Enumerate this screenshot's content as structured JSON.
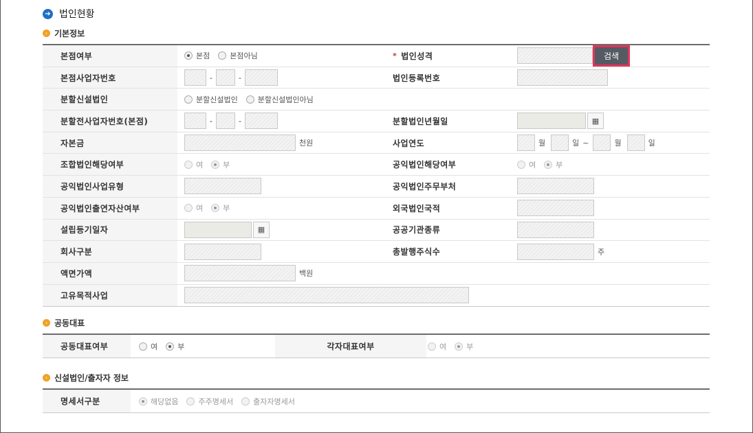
{
  "page_title": "법인현황",
  "basic": {
    "section_title": "기본정보",
    "rows": [
      {
        "label_a": "본점여부",
        "radio_a": [
          "본점",
          "본점아님"
        ],
        "label_b": "법인성격",
        "search_btn": "검색"
      },
      {
        "label_a": "본점사업자번호",
        "label_b": "법인등록번호"
      },
      {
        "label_a": "분할신설법인",
        "radio_a": [
          "분할신설법인",
          "분할신설법인아님"
        ]
      },
      {
        "label_a": "분할전사업자번호(본점)",
        "label_b": "분할법인년월일"
      },
      {
        "label_a": "자본금",
        "unit_a": "천원",
        "label_b": "사업연도",
        "fy_units": [
          "월",
          "일",
          "~",
          "월",
          "일"
        ]
      },
      {
        "label_a": "조합법인해당여부",
        "radio_a": [
          "여",
          "부"
        ],
        "label_b": "공익법인해당여부",
        "radio_b": [
          "여",
          "부"
        ]
      },
      {
        "label_a": "공익법인사업유형",
        "label_b": "공익법인주무부처"
      },
      {
        "label_a": "공익법인출연자산여부",
        "radio_a": [
          "여",
          "부"
        ],
        "label_b": "외국법인국적"
      },
      {
        "label_a": "설립등기일자",
        "label_b": "공공기관종류"
      },
      {
        "label_a": "회사구분",
        "label_b": "총발행주식수",
        "unit_b": "주"
      },
      {
        "label_a": "액면가액",
        "unit_a": "백원"
      },
      {
        "label_a": "고유목적사업"
      }
    ]
  },
  "joint": {
    "section_title": "공동대표",
    "label_a": "공동대표여부",
    "radio_a": [
      "여",
      "부"
    ],
    "label_b": "각자대표여부",
    "radio_b": [
      "여",
      "부"
    ]
  },
  "new_corp": {
    "section_title": "신설법인/출자자 정보",
    "label": "명세서구분",
    "options": [
      "해당없음",
      "주주명세서",
      "출자자명세서"
    ]
  }
}
